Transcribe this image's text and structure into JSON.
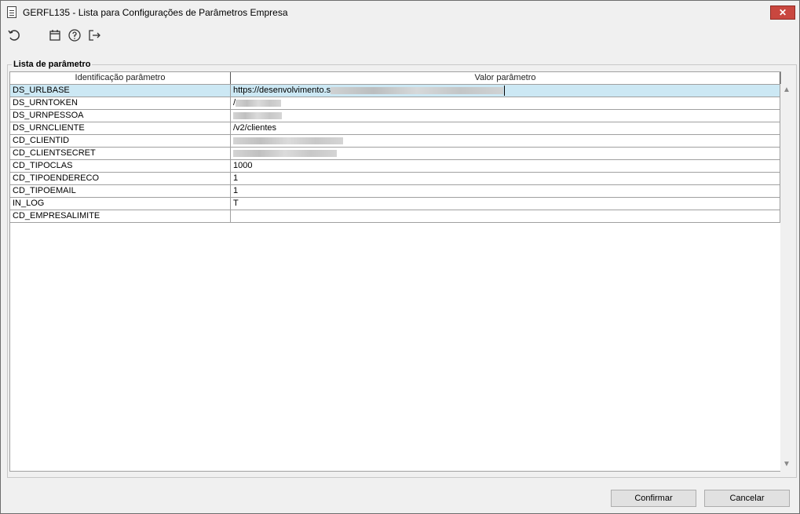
{
  "window": {
    "title": "GERFL135 - Lista para Configurações de Parâmetros Empresa",
    "close_glyph": "✕"
  },
  "toolbar": {
    "icons": [
      "refresh-icon",
      "calendar-icon",
      "help-icon",
      "exit-icon"
    ]
  },
  "group": {
    "legend": "Lista de parâmetro"
  },
  "grid": {
    "columns": [
      "Identificação parâmetro",
      "Valor parâmetro"
    ],
    "rows": [
      {
        "key": "DS_URLBASE",
        "value": "https://desenvolvimento.s"
      },
      {
        "key": "DS_URNTOKEN",
        "value": "/"
      },
      {
        "key": "DS_URNPESSOA",
        "value": ""
      },
      {
        "key": "DS_URNCLIENTE",
        "value": "/v2/clientes"
      },
      {
        "key": "CD_CLIENTID",
        "value": ""
      },
      {
        "key": "CD_CLIENTSECRET",
        "value": ""
      },
      {
        "key": "CD_TIPOCLAS",
        "value": "1000"
      },
      {
        "key": "CD_TIPOENDERECO",
        "value": "1"
      },
      {
        "key": "CD_TIPOEMAIL",
        "value": "1"
      },
      {
        "key": "IN_LOG",
        "value": "T"
      },
      {
        "key": "CD_EMPRESALIMITE",
        "value": ""
      }
    ]
  },
  "buttons": {
    "confirm": "Confirmar",
    "cancel": "Cancelar"
  }
}
